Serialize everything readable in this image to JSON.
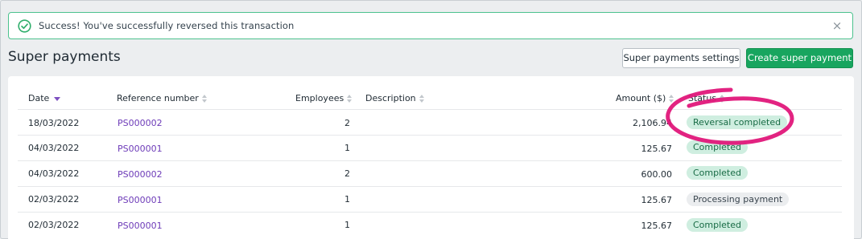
{
  "alert": {
    "message": "Success! You've successfully reversed this transaction",
    "close_glyph": "×",
    "accent_color": "#4cc28e"
  },
  "page": {
    "title": "Super payments",
    "settings_button": "Super payments settings",
    "create_button": "Create super payment",
    "primary_color": "#18a55f"
  },
  "table": {
    "columns": {
      "date": "Date",
      "reference": "Reference number",
      "employees": "Employees",
      "description": "Description",
      "amount": "Amount ($)",
      "status": "Status"
    },
    "rows": [
      {
        "date": "18/03/2022",
        "reference": "PS000002",
        "employees": "2",
        "description": "",
        "amount": "2,106.94",
        "status": "Reversal completed",
        "status_type": "green"
      },
      {
        "date": "04/03/2022",
        "reference": "PS000001",
        "employees": "1",
        "description": "",
        "amount": "125.67",
        "status": "Completed",
        "status_type": "green"
      },
      {
        "date": "04/03/2022",
        "reference": "PS000002",
        "employees": "2",
        "description": "",
        "amount": "600.00",
        "status": "Completed",
        "status_type": "green"
      },
      {
        "date": "02/03/2022",
        "reference": "PS000001",
        "employees": "1",
        "description": "",
        "amount": "125.67",
        "status": "Processing payment",
        "status_type": "grey"
      },
      {
        "date": "02/03/2022",
        "reference": "PS000001",
        "employees": "1",
        "description": "",
        "amount": "125.67",
        "status": "Completed",
        "status_type": "green"
      }
    ]
  },
  "annotation": {
    "color": "#e0177a"
  }
}
